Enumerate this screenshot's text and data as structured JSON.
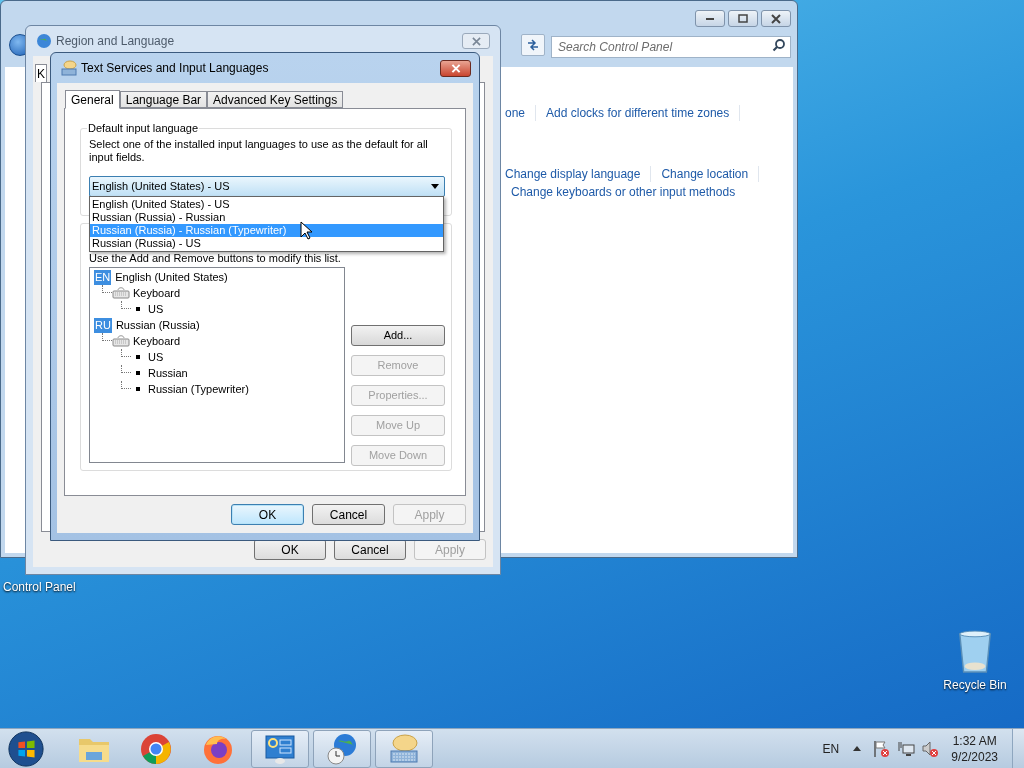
{
  "control_panel": {
    "search": {
      "placeholder": "Search Control Panel"
    },
    "link_rows": [
      [
        "one",
        "Add clocks for different time zones"
      ],
      [
        "Change display language",
        "Change location"
      ],
      [
        "Change keyboards or other input methods"
      ]
    ]
  },
  "region_dialog": {
    "title": "Region and Language",
    "tab": "K",
    "buttons": [
      {
        "label": "OK",
        "disabled": false,
        "default": false
      },
      {
        "label": "Cancel",
        "disabled": false,
        "default": false
      },
      {
        "label": "Apply",
        "disabled": true,
        "default": false
      }
    ]
  },
  "text_services_dialog": {
    "title": "Text Services and Input Languages",
    "tabs": [
      {
        "label": "General",
        "selected": true
      },
      {
        "label": "Language Bar",
        "selected": false
      },
      {
        "label": "Advanced Key Settings",
        "selected": false
      }
    ],
    "default_group": {
      "title": "Default input language",
      "description": "Select one of the installed input languages to use as the default for all input fields.",
      "combo": {
        "value": "English (United States) - US"
      },
      "options": [
        {
          "label": "English (United States) - US",
          "selected": false
        },
        {
          "label": "Russian (Russia) - Russian",
          "selected": false
        },
        {
          "label": "Russian (Russia) - Russian (Typewriter)",
          "selected": true
        },
        {
          "label": "Russian (Russia) - US",
          "selected": false
        }
      ]
    },
    "installed_hint": "Use the Add and Remove buttons to modify this list.",
    "tree": [
      {
        "badge": "EN",
        "label": "English (United States)",
        "children": [
          {
            "label": "Keyboard",
            "children": [
              {
                "label": "US"
              }
            ]
          }
        ]
      },
      {
        "badge": "RU",
        "label": "Russian (Russia)",
        "children": [
          {
            "label": "Keyboard",
            "children": [
              {
                "label": "US"
              },
              {
                "label": "Russian"
              },
              {
                "label": "Russian (Typewriter)"
              }
            ]
          }
        ]
      }
    ],
    "side_buttons": [
      {
        "label": "Add...",
        "disabled": false
      },
      {
        "label": "Remove",
        "disabled": true
      },
      {
        "label": "Properties...",
        "disabled": true
      },
      {
        "label": "Move Up",
        "disabled": true
      },
      {
        "label": "Move Down",
        "disabled": true
      }
    ],
    "buttons": [
      {
        "label": "OK",
        "disabled": false,
        "default": true
      },
      {
        "label": "Cancel",
        "disabled": false,
        "default": false
      },
      {
        "label": "Apply",
        "disabled": true,
        "default": false
      }
    ]
  },
  "desktop": {
    "control_panel_label": "Control Panel",
    "recycle_bin_label": "Recycle Bin"
  },
  "taskbar": {
    "items": [
      {
        "kind": "explorer",
        "running": false
      },
      {
        "kind": "chrome",
        "running": false
      },
      {
        "kind": "firefox",
        "running": false
      },
      {
        "kind": "control-panel",
        "running": true
      },
      {
        "kind": "globe-clock",
        "running": true
      },
      {
        "kind": "keyboard-bubble",
        "running": true
      }
    ],
    "tray": {
      "language": "EN",
      "time": "1:32 AM",
      "date": "9/2/2023"
    }
  }
}
